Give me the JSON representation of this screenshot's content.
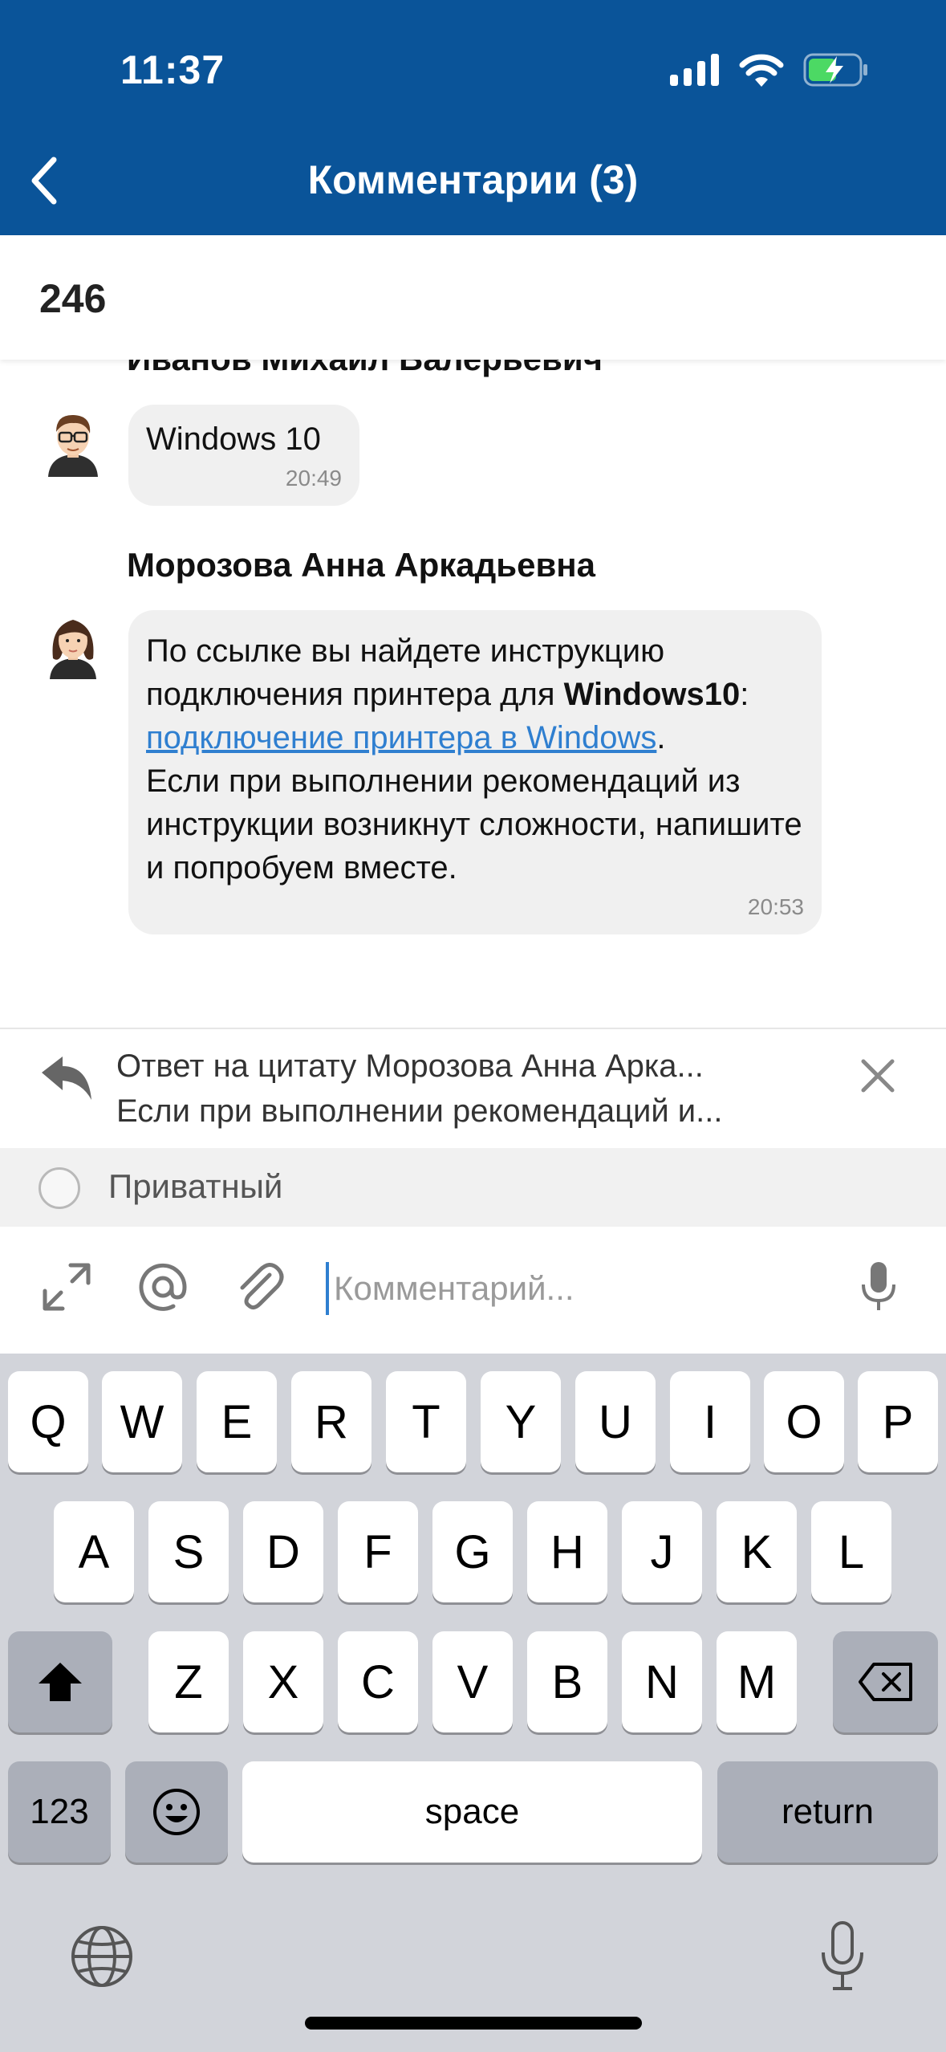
{
  "status_bar": {
    "time": "11:37"
  },
  "header": {
    "title": "Комментарии (3)"
  },
  "ticket": {
    "number": "246"
  },
  "comments": [
    {
      "author": "Иванов Михаил Валерьевич",
      "text": "Windows 10",
      "time": "20:49"
    },
    {
      "author": "Морозова Анна Аркадьевна",
      "text_intro": "По ссылке вы найдете инструкцию подключения принтера для ",
      "text_bold": "Windows10",
      "text_colon": ": ",
      "link_text": "подключение принтера в Windows",
      "text_dot": ".",
      "text_rest": "Если при выполнении рекомендаций из инструкции возникнут сложности, напишите и попробуем вместе.",
      "time": "20:53"
    }
  ],
  "reply": {
    "title": "Ответ на цитату Морозова Анна Арка...",
    "text": "Если при выполнении рекомендаций и..."
  },
  "private_label": "Приватный",
  "input": {
    "placeholder": "Комментарий..."
  },
  "keyboard": {
    "row1": [
      "Q",
      "W",
      "E",
      "R",
      "T",
      "Y",
      "U",
      "I",
      "O",
      "P"
    ],
    "row2": [
      "A",
      "S",
      "D",
      "F",
      "G",
      "H",
      "J",
      "K",
      "L"
    ],
    "row3": [
      "Z",
      "X",
      "C",
      "V",
      "B",
      "N",
      "M"
    ],
    "numbers": "123",
    "space": "space",
    "return": "return"
  },
  "colors": {
    "header_bg": "#0a5499",
    "link": "#2f7fd0",
    "bubble_bg": "#f0f0f0",
    "keyboard_bg": "#d2d4da"
  }
}
